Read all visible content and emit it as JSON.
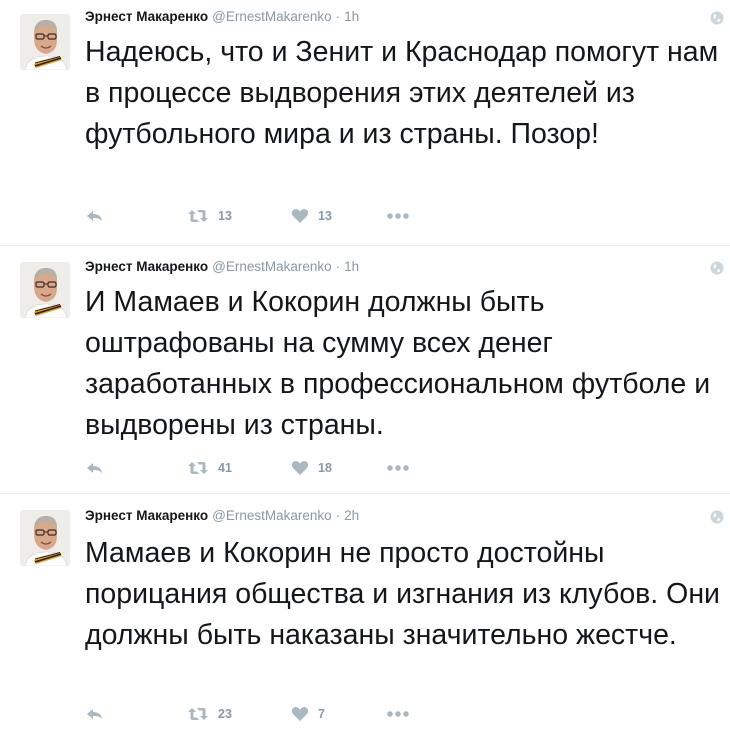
{
  "tweets": [
    {
      "fullname": "Эрнест Макаренко",
      "username": "@ErnestMakarenko",
      "separator": "·",
      "time": "1h",
      "text": "Надеюсь, что и Зенит и Краснодар помогут нам в процессе выдворения этих деятелей из футбольного мира и из страны. Позор!",
      "retweets": "13",
      "likes": "13"
    },
    {
      "fullname": "Эрнест Макаренко",
      "username": "@ErnestMakarenko",
      "separator": "·",
      "time": "1h",
      "text": "И Мамаев и Кокорин должны быть оштрафованы на сумму всех денег заработанных в профессиональном футболе и выдворены из страны.",
      "retweets": "41",
      "likes": "18"
    },
    {
      "fullname": "Эрнест Макаренко",
      "username": "@ErnestMakarenko",
      "separator": "·",
      "time": "2h",
      "text": "Мамаев и Кокорин не просто достойны порицания общества и изгнания из клубов. Они должны быть наказаны значительно жестче.",
      "retweets": "23",
      "likes": "7"
    }
  ],
  "icons": {
    "reply": "reply-icon",
    "retweet": "retweet-icon",
    "like": "heart-icon",
    "more": "more-icon",
    "globe": "globe-icon",
    "avatar": "avatar"
  },
  "colors": {
    "name": "#14171a",
    "meta": "#8899a6",
    "action": "#aab8c2",
    "divider": "#e6ecf0"
  }
}
